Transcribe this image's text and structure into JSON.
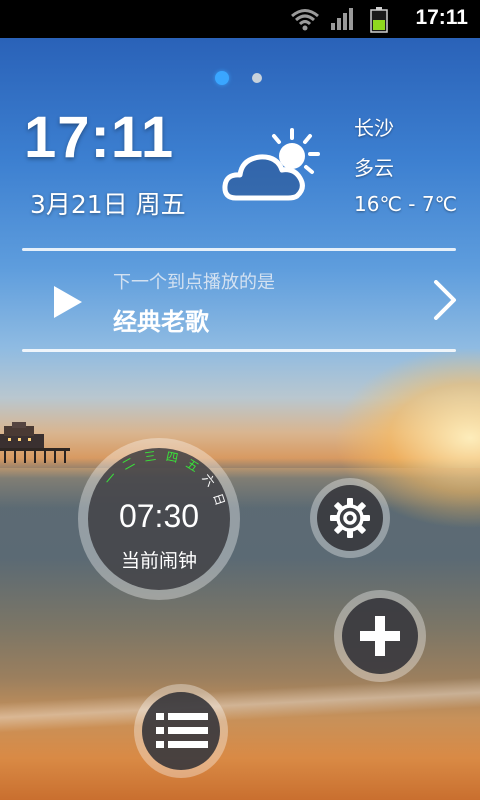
{
  "status_bar": {
    "time": "17:11"
  },
  "pager": {
    "count": 2,
    "active_index": 0
  },
  "clock": {
    "time": "17:11",
    "date": "3月21日 周五"
  },
  "weather": {
    "icon": "partly-cloudy-icon",
    "city": "长沙",
    "condition": "多云",
    "temp_range": "16℃ - 7℃"
  },
  "playback": {
    "caption": "下一个到点播放的是",
    "title": "经典老歌",
    "play_icon": "play-icon",
    "next_icon": "chevron-right-icon"
  },
  "alarm": {
    "time": "07:30",
    "label": "当前闹钟",
    "days": [
      "一",
      "二",
      "三",
      "四",
      "五",
      "六",
      "日"
    ],
    "active_days": [
      true,
      true,
      true,
      true,
      true,
      false,
      false
    ],
    "active_color": "#39e33a",
    "inactive_color": "#ffffff"
  },
  "buttons": {
    "settings_icon": "gear-icon",
    "add_icon": "plus-icon",
    "list_icon": "list-icon"
  },
  "colors": {
    "accent": "#3aa6ff"
  }
}
